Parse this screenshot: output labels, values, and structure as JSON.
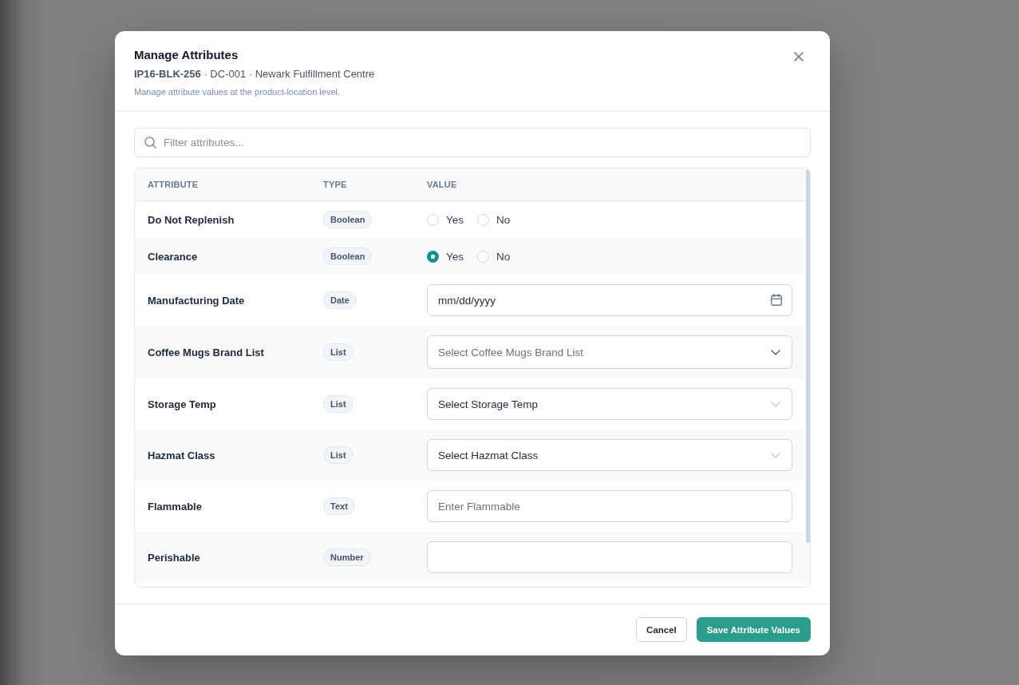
{
  "dialog": {
    "title": "Manage Attributes",
    "subtitle": "**IP16-BLK-256** · DC-001 · Newark Fulfillment Centre",
    "description": "Manage attribute values at the product-location level."
  },
  "search": {
    "placeholder": "Filter attributes..."
  },
  "table": {
    "columns": [
      "ATTRIBUTE",
      "TYPE",
      "VALUE"
    ],
    "rows": [
      {
        "attribute": "Do Not Replenish",
        "type": "Boolean",
        "kind": "boolean",
        "options": [
          {
            "label": "Yes",
            "selected": false
          },
          {
            "label": "No",
            "selected": false
          }
        ]
      },
      {
        "attribute": "Clearance",
        "type": "Boolean",
        "kind": "boolean",
        "options": [
          {
            "label": "Yes",
            "selected": true
          },
          {
            "label": "No",
            "selected": false
          }
        ]
      },
      {
        "attribute": "Manufacturing Date",
        "type": "Date",
        "kind": "date",
        "placeholder": "mm/dd/yyyy"
      },
      {
        "attribute": "Coffee Mugs Brand List",
        "type": "List",
        "kind": "select",
        "placeholder": "Select Coffee Mugs Brand List"
      },
      {
        "attribute": "Storage Temp",
        "type": "List",
        "kind": "select",
        "value": "Select Storage Temp"
      },
      {
        "attribute": "Hazmat Class",
        "type": "List",
        "kind": "select",
        "value": "Select Hazmat Class"
      },
      {
        "attribute": "Flammable",
        "type": "Text",
        "kind": "text",
        "placeholder": "Enter Flammable"
      },
      {
        "attribute": "Perishable",
        "type": "Number",
        "kind": "number"
      }
    ]
  },
  "buttons": [
    {
      "label": "Cancel",
      "kind": "secondary"
    },
    {
      "label": "Save Attribute Values",
      "kind": "primary"
    }
  ]
}
